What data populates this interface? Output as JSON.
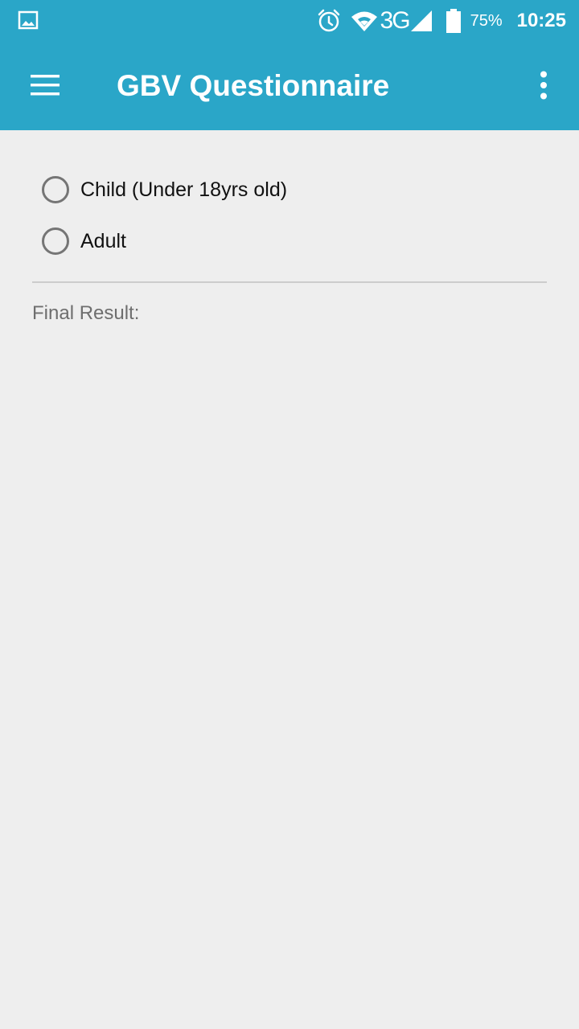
{
  "status_bar": {
    "network": "3G",
    "battery_percent": "75%",
    "time": "10:25",
    "icons": [
      "gallery-icon",
      "alarm-icon",
      "wifi-icon",
      "signal-icon",
      "battery-icon"
    ]
  },
  "app_bar": {
    "title": "GBV Questionnaire",
    "icons": [
      "menu-icon",
      "more-vert-icon"
    ]
  },
  "form": {
    "options": [
      {
        "label": "Child (Under 18yrs old)",
        "selected": false
      },
      {
        "label": "Adult",
        "selected": false
      }
    ],
    "result_label": "Final Result:"
  },
  "colors": {
    "primary": "#2aa6c8",
    "background": "#eeeeee",
    "radio": "#757575"
  }
}
